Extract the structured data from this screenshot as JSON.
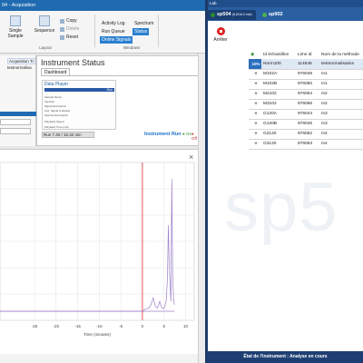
{
  "left_app": {
    "title": "04 - Acquisition",
    "ribbon": {
      "single_sample": "Single Sample",
      "sequence": "Sequence",
      "copy": "Copy",
      "delete": "Delete",
      "reset": "Reset",
      "group_layout": "Layout",
      "windows": {
        "items": [
          "Activity Log",
          "Spectrum",
          "Run Queue",
          "Status",
          "Online Signals"
        ],
        "selected": [
          "Status",
          "Online Signals"
        ],
        "group_label": "Windows"
      },
      "acquisition_tab": "Acquisition Tr",
      "test_label": "testnormalisa"
    },
    "instrument_status": {
      "title": "Instrument Status",
      "tab": "Dashboard",
      "data_player_title": "Data Player",
      "bar_label": "Run",
      "details": [
        "Sample Name",
        "Injection",
        "Signal Description",
        "Acq. Signal & Details",
        "Spectra Description",
        "Playback Speed",
        "Playback Time (min)"
      ],
      "run_line": "Run 7.40 / 16.32 min",
      "instrument_run": "Instrument  Run",
      "on_label": "On",
      "off_label": "Off"
    },
    "chart_close": "×",
    "chart_data": {
      "type": "line",
      "xlabel": "Time (minutes)",
      "x_ticks": [
        -25,
        -20,
        -15,
        -10,
        -5,
        0,
        5,
        10
      ],
      "xlim": [
        -33,
        12
      ],
      "series": [
        {
          "x": [
            -33,
            -1,
            -0.5,
            0,
            0.5,
            1,
            1.5,
            2,
            2.5,
            3,
            3.5,
            4,
            4.5,
            5,
            5.5,
            5.8,
            6,
            6.2,
            6.4,
            6.6,
            6.8,
            7,
            7.2,
            7.4
          ],
          "y": [
            0,
            0,
            0,
            0,
            0.5,
            0.8,
            1,
            2,
            4,
            1.5,
            1,
            3,
            1,
            0.8,
            3,
            10,
            26,
            14,
            8,
            3,
            40,
            12,
            4,
            2
          ],
          "color": "#9b7fc8"
        }
      ],
      "red_marker_x": 0,
      "trace_end_x": 7.4,
      "grid": true
    }
  },
  "right_app": {
    "title": "Lab",
    "tabs": [
      {
        "name": "sp504",
        "detail": "(5.8/16.3 min)",
        "dot_color": "#2c8a2c"
      },
      {
        "name": "sp902",
        "detail": "",
        "dot_color": "#4caf50"
      }
    ],
    "stop_button": "Arrêter",
    "table": {
      "headers": [
        "",
        "Id échantillon",
        "Lims Id",
        "Nom de la méthode"
      ],
      "rows": [
        {
          "pct": "10%",
          "id": "Norm100",
          "lims": "114648",
          "method": "testnormalisation"
        },
        {
          "id": "M102A",
          "lims": "976048",
          "method": "m1"
        },
        {
          "id": "M102B",
          "lims": "976050",
          "method": "m1"
        },
        {
          "id": "M2102",
          "lims": "976054",
          "method": "m2"
        },
        {
          "id": "M3102",
          "lims": "976056",
          "method": "m2"
        },
        {
          "id": "G120A",
          "lims": "976044",
          "method": "m3"
        },
        {
          "id": "G120B",
          "lims": "976046",
          "method": "m3"
        },
        {
          "id": "G2120",
          "lims": "976052",
          "method": "m4"
        },
        {
          "id": "G3120",
          "lims": "976053",
          "method": "m4"
        }
      ]
    },
    "watermark": "sp5",
    "footer": "État de l'instrument : Analyse en cours"
  }
}
